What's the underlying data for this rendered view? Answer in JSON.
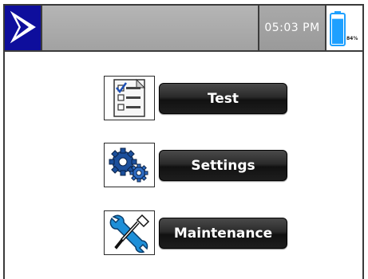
{
  "status_bar": {
    "time": "05:03 PM",
    "battery_percent_label": "84%",
    "battery_level": 0.84,
    "logo_icon": "chevron-right-logo-icon",
    "accent": "#0e0e9c",
    "battery_color": "#1ea0ff"
  },
  "menu": {
    "items": [
      {
        "label": "Test",
        "icon": "checklist-icon"
      },
      {
        "label": "Settings",
        "icon": "gears-icon"
      },
      {
        "label": "Maintenance",
        "icon": "wrench-screwdriver-icon"
      }
    ]
  }
}
